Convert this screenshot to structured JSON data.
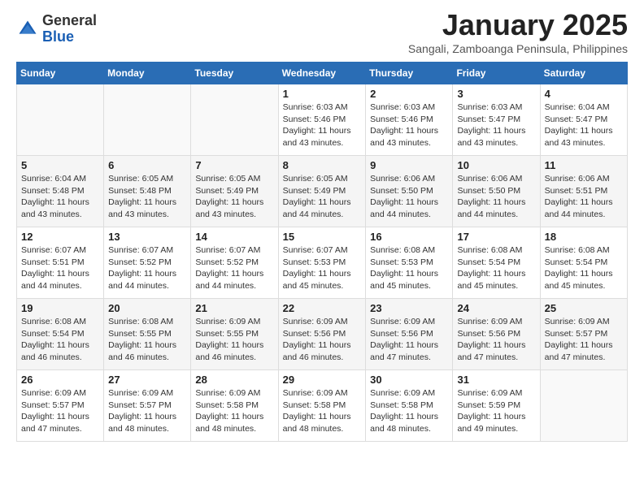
{
  "header": {
    "logo_general": "General",
    "logo_blue": "Blue",
    "month": "January 2025",
    "location": "Sangali, Zamboanga Peninsula, Philippines"
  },
  "weekdays": [
    "Sunday",
    "Monday",
    "Tuesday",
    "Wednesday",
    "Thursday",
    "Friday",
    "Saturday"
  ],
  "weeks": [
    [
      {
        "day": "",
        "sunrise": "",
        "sunset": "",
        "daylight": ""
      },
      {
        "day": "",
        "sunrise": "",
        "sunset": "",
        "daylight": ""
      },
      {
        "day": "",
        "sunrise": "",
        "sunset": "",
        "daylight": ""
      },
      {
        "day": "1",
        "sunrise": "Sunrise: 6:03 AM",
        "sunset": "Sunset: 5:46 PM",
        "daylight": "Daylight: 11 hours and 43 minutes."
      },
      {
        "day": "2",
        "sunrise": "Sunrise: 6:03 AM",
        "sunset": "Sunset: 5:46 PM",
        "daylight": "Daylight: 11 hours and 43 minutes."
      },
      {
        "day": "3",
        "sunrise": "Sunrise: 6:03 AM",
        "sunset": "Sunset: 5:47 PM",
        "daylight": "Daylight: 11 hours and 43 minutes."
      },
      {
        "day": "4",
        "sunrise": "Sunrise: 6:04 AM",
        "sunset": "Sunset: 5:47 PM",
        "daylight": "Daylight: 11 hours and 43 minutes."
      }
    ],
    [
      {
        "day": "5",
        "sunrise": "Sunrise: 6:04 AM",
        "sunset": "Sunset: 5:48 PM",
        "daylight": "Daylight: 11 hours and 43 minutes."
      },
      {
        "day": "6",
        "sunrise": "Sunrise: 6:05 AM",
        "sunset": "Sunset: 5:48 PM",
        "daylight": "Daylight: 11 hours and 43 minutes."
      },
      {
        "day": "7",
        "sunrise": "Sunrise: 6:05 AM",
        "sunset": "Sunset: 5:49 PM",
        "daylight": "Daylight: 11 hours and 43 minutes."
      },
      {
        "day": "8",
        "sunrise": "Sunrise: 6:05 AM",
        "sunset": "Sunset: 5:49 PM",
        "daylight": "Daylight: 11 hours and 44 minutes."
      },
      {
        "day": "9",
        "sunrise": "Sunrise: 6:06 AM",
        "sunset": "Sunset: 5:50 PM",
        "daylight": "Daylight: 11 hours and 44 minutes."
      },
      {
        "day": "10",
        "sunrise": "Sunrise: 6:06 AM",
        "sunset": "Sunset: 5:50 PM",
        "daylight": "Daylight: 11 hours and 44 minutes."
      },
      {
        "day": "11",
        "sunrise": "Sunrise: 6:06 AM",
        "sunset": "Sunset: 5:51 PM",
        "daylight": "Daylight: 11 hours and 44 minutes."
      }
    ],
    [
      {
        "day": "12",
        "sunrise": "Sunrise: 6:07 AM",
        "sunset": "Sunset: 5:51 PM",
        "daylight": "Daylight: 11 hours and 44 minutes."
      },
      {
        "day": "13",
        "sunrise": "Sunrise: 6:07 AM",
        "sunset": "Sunset: 5:52 PM",
        "daylight": "Daylight: 11 hours and 44 minutes."
      },
      {
        "day": "14",
        "sunrise": "Sunrise: 6:07 AM",
        "sunset": "Sunset: 5:52 PM",
        "daylight": "Daylight: 11 hours and 44 minutes."
      },
      {
        "day": "15",
        "sunrise": "Sunrise: 6:07 AM",
        "sunset": "Sunset: 5:53 PM",
        "daylight": "Daylight: 11 hours and 45 minutes."
      },
      {
        "day": "16",
        "sunrise": "Sunrise: 6:08 AM",
        "sunset": "Sunset: 5:53 PM",
        "daylight": "Daylight: 11 hours and 45 minutes."
      },
      {
        "day": "17",
        "sunrise": "Sunrise: 6:08 AM",
        "sunset": "Sunset: 5:54 PM",
        "daylight": "Daylight: 11 hours and 45 minutes."
      },
      {
        "day": "18",
        "sunrise": "Sunrise: 6:08 AM",
        "sunset": "Sunset: 5:54 PM",
        "daylight": "Daylight: 11 hours and 45 minutes."
      }
    ],
    [
      {
        "day": "19",
        "sunrise": "Sunrise: 6:08 AM",
        "sunset": "Sunset: 5:54 PM",
        "daylight": "Daylight: 11 hours and 46 minutes."
      },
      {
        "day": "20",
        "sunrise": "Sunrise: 6:08 AM",
        "sunset": "Sunset: 5:55 PM",
        "daylight": "Daylight: 11 hours and 46 minutes."
      },
      {
        "day": "21",
        "sunrise": "Sunrise: 6:09 AM",
        "sunset": "Sunset: 5:55 PM",
        "daylight": "Daylight: 11 hours and 46 minutes."
      },
      {
        "day": "22",
        "sunrise": "Sunrise: 6:09 AM",
        "sunset": "Sunset: 5:56 PM",
        "daylight": "Daylight: 11 hours and 46 minutes."
      },
      {
        "day": "23",
        "sunrise": "Sunrise: 6:09 AM",
        "sunset": "Sunset: 5:56 PM",
        "daylight": "Daylight: 11 hours and 47 minutes."
      },
      {
        "day": "24",
        "sunrise": "Sunrise: 6:09 AM",
        "sunset": "Sunset: 5:56 PM",
        "daylight": "Daylight: 11 hours and 47 minutes."
      },
      {
        "day": "25",
        "sunrise": "Sunrise: 6:09 AM",
        "sunset": "Sunset: 5:57 PM",
        "daylight": "Daylight: 11 hours and 47 minutes."
      }
    ],
    [
      {
        "day": "26",
        "sunrise": "Sunrise: 6:09 AM",
        "sunset": "Sunset: 5:57 PM",
        "daylight": "Daylight: 11 hours and 47 minutes."
      },
      {
        "day": "27",
        "sunrise": "Sunrise: 6:09 AM",
        "sunset": "Sunset: 5:57 PM",
        "daylight": "Daylight: 11 hours and 48 minutes."
      },
      {
        "day": "28",
        "sunrise": "Sunrise: 6:09 AM",
        "sunset": "Sunset: 5:58 PM",
        "daylight": "Daylight: 11 hours and 48 minutes."
      },
      {
        "day": "29",
        "sunrise": "Sunrise: 6:09 AM",
        "sunset": "Sunset: 5:58 PM",
        "daylight": "Daylight: 11 hours and 48 minutes."
      },
      {
        "day": "30",
        "sunrise": "Sunrise: 6:09 AM",
        "sunset": "Sunset: 5:58 PM",
        "daylight": "Daylight: 11 hours and 48 minutes."
      },
      {
        "day": "31",
        "sunrise": "Sunrise: 6:09 AM",
        "sunset": "Sunset: 5:59 PM",
        "daylight": "Daylight: 11 hours and 49 minutes."
      },
      {
        "day": "",
        "sunrise": "",
        "sunset": "",
        "daylight": ""
      }
    ]
  ]
}
